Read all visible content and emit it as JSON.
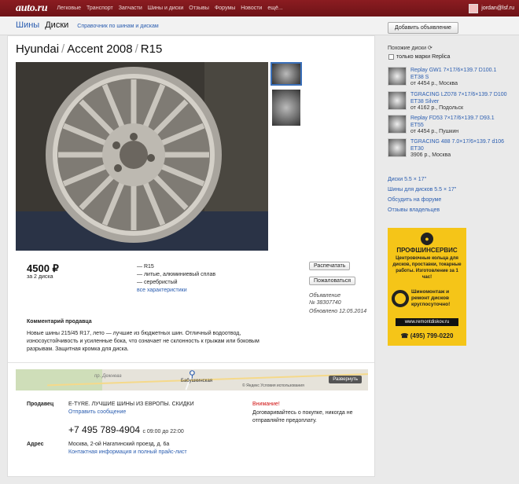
{
  "topbar": {
    "logo": "auto.ru",
    "nav": [
      "Легковые",
      "Транспорт",
      "Запчасти",
      "Шины и диски",
      "Отзывы",
      "Форумы",
      "Новости",
      "ещё..."
    ],
    "user": "jordan@lsf.ru"
  },
  "subheader": {
    "tab_tires": "Шины",
    "tab_wheels": "Диски",
    "reference_link": "Справочник по шинам и дискам"
  },
  "listing": {
    "title_make": "Hyundai",
    "title_model": "Accent 2008",
    "title_size": "R15",
    "price": "4500 ₽",
    "price_note": "за 2 диска",
    "specs": [
      "— R15",
      "— литые, алюминиевый сплав",
      "— серебристый"
    ],
    "all_specs_link": "все характеристики",
    "print_button": "Распечатать",
    "complain_button": "Пожаловаться",
    "ad_label": "Объявление",
    "ad_number": "№ 38307740",
    "updated": "Обновлено 12.05.2014",
    "comment_heading": "Комментарий продавца",
    "comment_text": "Новые шины 215/45 R17, лето — лучшие из бюджетных шин. Отличный водоотвод, износоустойчивость и усиленные бока, что означает не склонность к грыжам или боковым разрывам. Защитная кромка для диска."
  },
  "map": {
    "street": "пр. Дежнева",
    "station": "Бабушкинская",
    "copyright": "© Яндекс   Условия использования",
    "expand_button": "Развернуть"
  },
  "seller": {
    "label": "Продавец",
    "name": "E-TYRE. ЛУЧШИЕ ШИНЫ ИЗ ЕВРОПЫ. СКИДКИ",
    "send_message": "Отправить сообщение",
    "phone": "+7 495 789-4904",
    "hours": "с 09:00 до 22:00",
    "warning_title": "Внимание!",
    "warning_text": "Договаривайтесь о покупке, никогда не отправляйте предоплату.",
    "address_label": "Адрес",
    "address": "Москва, 2-ой Нагатинский проезд, д. 6а",
    "contact_link": "Контактная информация и полный прайс-лист"
  },
  "sidebar": {
    "add_button": "Добавить объявление",
    "similar_heading": "Похожие диски",
    "replica_label": "только марки Replica",
    "items": [
      {
        "title": "Replay GW1 7×17/6×139.7 D100.1 ET38 S",
        "price": "от 4454 р., Москва"
      },
      {
        "title": "TGRACING LZ078 7×17/6×139.7 D100 ET38 Silver",
        "price": "от 4162 р., Подольск"
      },
      {
        "title": "Replay FD53 7×17/6×139.7 D93.1 ET55",
        "price": "от 4454 р., Пушкин"
      },
      {
        "title": "TGRACING 488 7.0×17/6×139.7 d106 ET30",
        "price": "3906 р., Москва"
      }
    ],
    "links": [
      "Диски 5.5 × 17\"",
      "Шины для дисков 5.5 × 17\"",
      "Обсудить на форуме",
      "Отзывы владельцев"
    ]
  },
  "ad": {
    "brand": "ПРОФШИНСЕРВИС",
    "text": "Центровочные кольца для дисков, проставки, токарные работы. Изготовление за 1 час!",
    "service": "Шиномонтаж и ремонт дисков круглосуточно!",
    "url": "www.remontdiskov.ru",
    "phone": "☎ (495) 799-0220"
  }
}
